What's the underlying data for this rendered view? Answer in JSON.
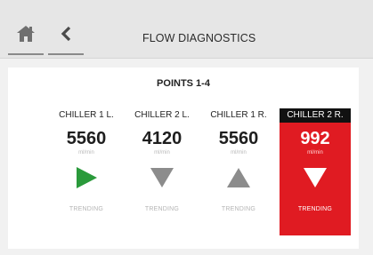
{
  "header": {
    "title": "FLOW DIAGNOSTICS",
    "home_icon": "home-icon",
    "back_icon": "chevron-left-icon"
  },
  "section": {
    "title": "POINTS 1-4"
  },
  "cards": [
    {
      "name": "CHILLER 1 L.",
      "value": "5560",
      "unit": "ml/min",
      "trend": "right",
      "trend_icon": "play-right-icon",
      "footer": "TRENDING",
      "alert": false,
      "icon_color": "#2a9a3b"
    },
    {
      "name": "CHILLER 2 L.",
      "value": "4120",
      "unit": "ml/min",
      "trend": "down",
      "trend_icon": "triangle-down-icon",
      "footer": "TRENDING",
      "alert": false,
      "icon_color": "#8c8c8c"
    },
    {
      "name": "CHILLER 1 R.",
      "value": "5560",
      "unit": "ml/min",
      "trend": "up",
      "trend_icon": "triangle-up-icon",
      "footer": "TRENDING",
      "alert": false,
      "icon_color": "#8c8c8c"
    },
    {
      "name": "CHILLER 2 R.",
      "value": "992",
      "unit": "ml/min",
      "trend": "down",
      "trend_icon": "triangle-down-icon",
      "footer": "TRENDING",
      "alert": true,
      "icon_color": "#ffffff"
    }
  ],
  "colors": {
    "alert_bg": "#e01b22",
    "alert_header_bg": "#111111",
    "trend_green": "#2a9a3b",
    "trend_gray": "#8c8c8c"
  }
}
